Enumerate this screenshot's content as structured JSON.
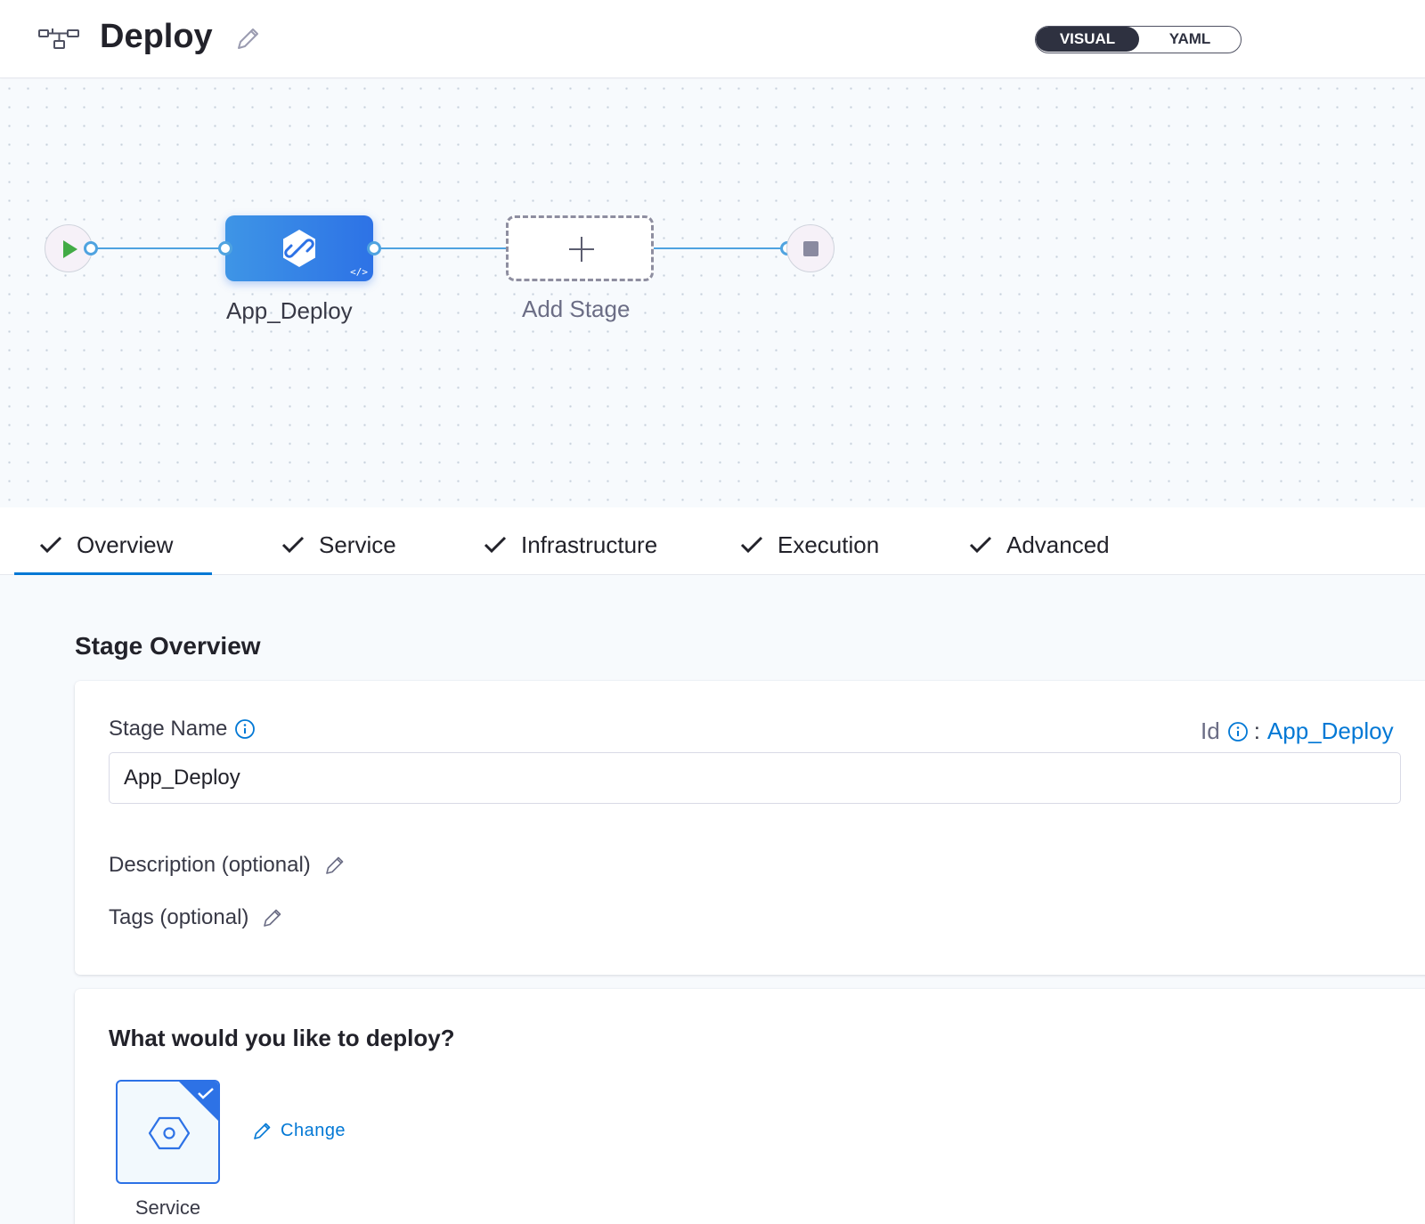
{
  "header": {
    "title": "Deploy",
    "view_toggle": {
      "visual": "VISUAL",
      "yaml": "YAML",
      "selected": "VISUAL"
    }
  },
  "canvas": {
    "stages": [
      {
        "label": "App_Deploy",
        "icon": "link-hex-icon"
      }
    ],
    "add_stage_label": "Add Stage"
  },
  "tabs": [
    {
      "label": "Overview",
      "complete": true,
      "active": true
    },
    {
      "label": "Service",
      "complete": true,
      "active": false
    },
    {
      "label": "Infrastructure",
      "complete": true,
      "active": false
    },
    {
      "label": "Execution",
      "complete": true,
      "active": false
    },
    {
      "label": "Advanced",
      "complete": true,
      "active": false
    }
  ],
  "overview": {
    "section_title": "Stage Overview",
    "stage_name_label": "Stage Name",
    "stage_name_value": "App_Deploy",
    "id_label": "Id",
    "id_separator": ":",
    "id_value": "App_Deploy",
    "description_label": "Description (optional)",
    "tags_label": "Tags (optional)"
  },
  "deploy": {
    "question": "What would you like to deploy?",
    "selected_type": "Service",
    "change_label": "Change"
  },
  "colors": {
    "accent": "#0278d5",
    "stage_blue": "#2d72e6",
    "edge": "#4fa3e0",
    "toggle_dark": "#2e3140",
    "play_green": "#42ab45"
  }
}
